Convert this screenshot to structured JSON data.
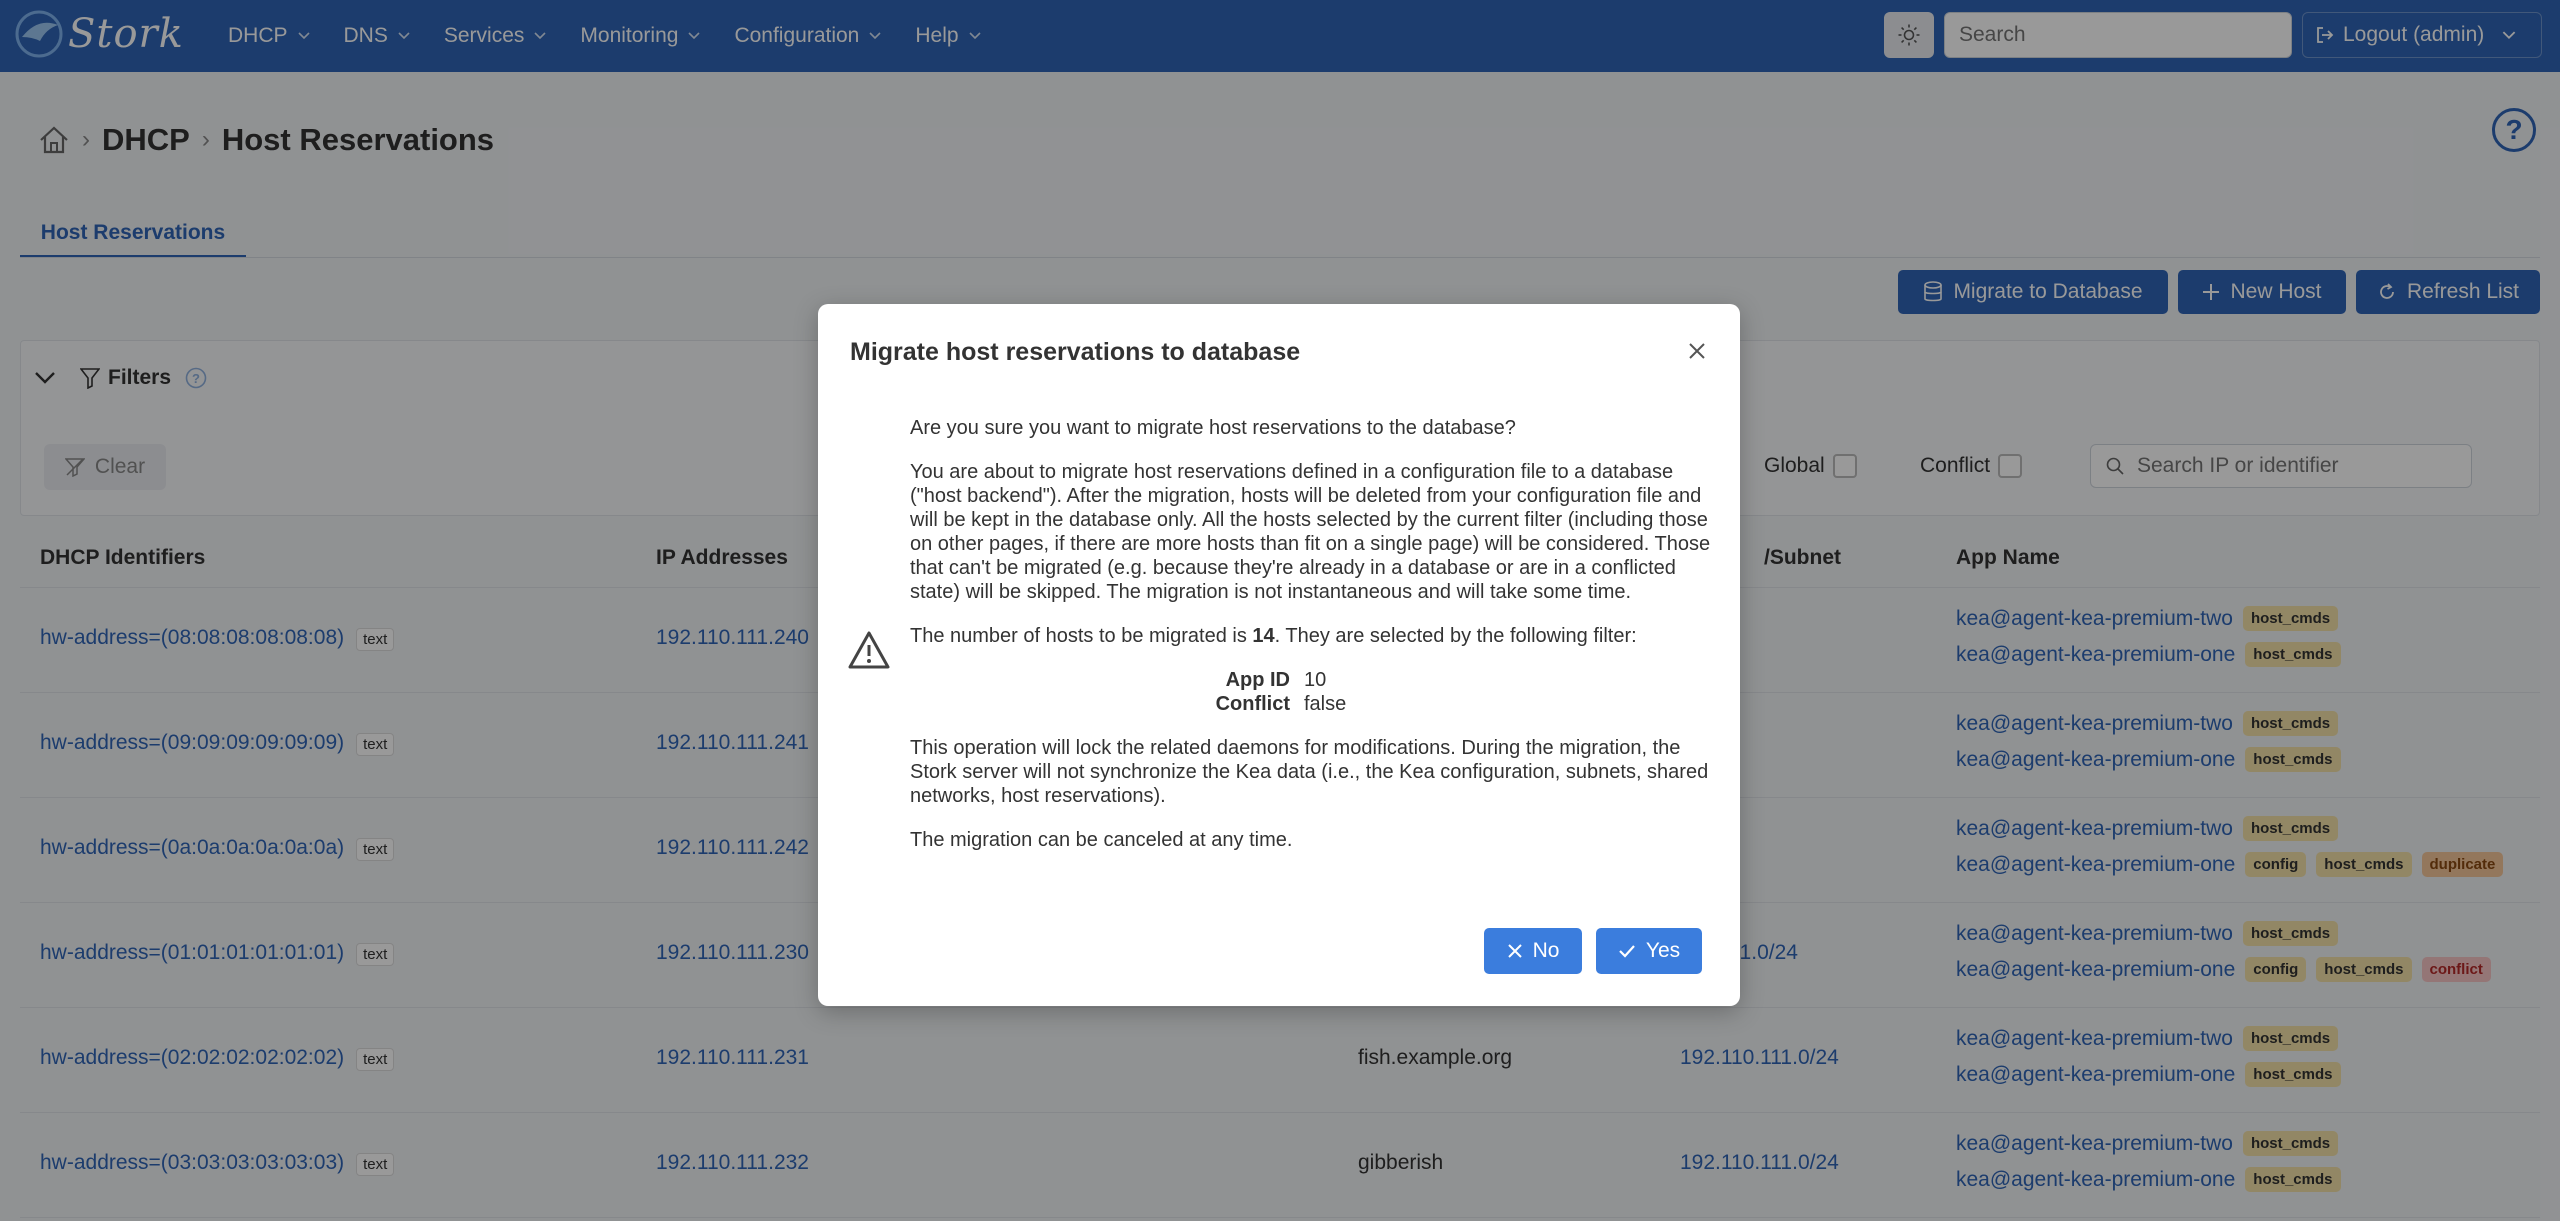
{
  "navbar": {
    "brand": "Stork",
    "menu": [
      "DHCP",
      "DNS",
      "Services",
      "Monitoring",
      "Configuration",
      "Help"
    ],
    "search_placeholder": "Search",
    "logout_label": "Logout (admin)"
  },
  "breadcrumb": {
    "section": "DHCP",
    "page": "Host Reservations"
  },
  "tab": {
    "label": "Host Reservations"
  },
  "actions": {
    "migrate": "Migrate to Database",
    "new_host": "New Host",
    "refresh": "Refresh List"
  },
  "filters": {
    "title": "Filters",
    "clear": "Clear",
    "global": "Global",
    "conflict": "Conflict",
    "search_placeholder": "Search IP or identifier"
  },
  "table": {
    "headers": {
      "identifiers": "DHCP Identifiers",
      "ip": "IP Addresses",
      "subnet": "/Subnet",
      "app": "App Name"
    },
    "id_tag": "text",
    "rows": [
      {
        "id": "hw-address=(08:08:08:08:08:08)",
        "ip": "192.110.111.240",
        "hostname": "",
        "subnet": "",
        "app1": "kea@agent-kea-premium-two",
        "app1_badges": [
          "host_cmds"
        ],
        "app2": "kea@agent-kea-premium-one",
        "app2_badges": [
          "host_cmds"
        ]
      },
      {
        "id": "hw-address=(09:09:09:09:09:09)",
        "ip": "192.110.111.241",
        "hostname": "",
        "subnet": "",
        "app1": "kea@agent-kea-premium-two",
        "app1_badges": [
          "host_cmds"
        ],
        "app2": "kea@agent-kea-premium-one",
        "app2_badges": [
          "host_cmds"
        ]
      },
      {
        "id": "hw-address=(0a:0a:0a:0a:0a:0a)",
        "ip": "192.110.111.242",
        "hostname": "",
        "subnet": "",
        "app1": "kea@agent-kea-premium-two",
        "app1_badges": [
          "host_cmds"
        ],
        "app2": "kea@agent-kea-premium-one",
        "app2_badges": [
          "config",
          "host_cmds",
          "duplicate"
        ]
      },
      {
        "id": "hw-address=(01:01:01:01:01:01)",
        "ip": "192.110.111.230",
        "hostname": "",
        "subnet": "110.111.0/24",
        "app1": "kea@agent-kea-premium-two",
        "app1_badges": [
          "host_cmds"
        ],
        "app2": "kea@agent-kea-premium-one",
        "app2_badges": [
          "config",
          "host_cmds",
          "conflict"
        ]
      },
      {
        "id": "hw-address=(02:02:02:02:02:02)",
        "ip": "192.110.111.231",
        "hostname": "fish.example.org",
        "subnet": "192.110.111.0/24",
        "app1": "kea@agent-kea-premium-two",
        "app1_badges": [
          "host_cmds"
        ],
        "app2": "kea@agent-kea-premium-one",
        "app2_badges": [
          "host_cmds"
        ]
      },
      {
        "id": "hw-address=(03:03:03:03:03:03)",
        "ip": "192.110.111.232",
        "hostname": "gibberish",
        "subnet": "192.110.111.0/24",
        "app1": "kea@agent-kea-premium-two",
        "app1_badges": [
          "host_cmds"
        ],
        "app2": "kea@agent-kea-premium-one",
        "app2_badges": [
          "host_cmds"
        ]
      }
    ]
  },
  "dialog": {
    "title": "Migrate host reservations to database",
    "question": "Are you sure you want to migrate host reservations to the database?",
    "description": "You are about to migrate host reservations defined in a configuration file to a database (\"host backend\"). After the migration, hosts will be deleted from your configuration file and will be kept in the database only. All the hosts selected by the current filter (including those on other pages, if there are more hosts than fit on a single page) will be considered. Those that can't be migrated (e.g. because they're already in a database or are in a conflicted state) will be skipped. The migration is not instantaneous and will take some time.",
    "count_prefix": "The number of hosts to be migrated is ",
    "count": "14",
    "count_suffix": ". They are selected by the following filter:",
    "filter": [
      {
        "key": "App ID",
        "value": "10"
      },
      {
        "key": "Conflict",
        "value": "false"
      }
    ],
    "lock_note": "This operation will lock the related daemons for modifications. During the migration, the Stork server will not synchronize the Kea data (i.e., the Kea configuration, subnets, shared networks, host reservations).",
    "cancel_note": "The migration can be canceled at any time.",
    "no_label": "No",
    "yes_label": "Yes"
  },
  "colors": {
    "primary": "#2f65b6",
    "dialog_button": "#3b7ddd",
    "badge_yellow": "#f4e2a8",
    "badge_orange": "#f5c69a",
    "badge_red": "#f7c5c5"
  }
}
